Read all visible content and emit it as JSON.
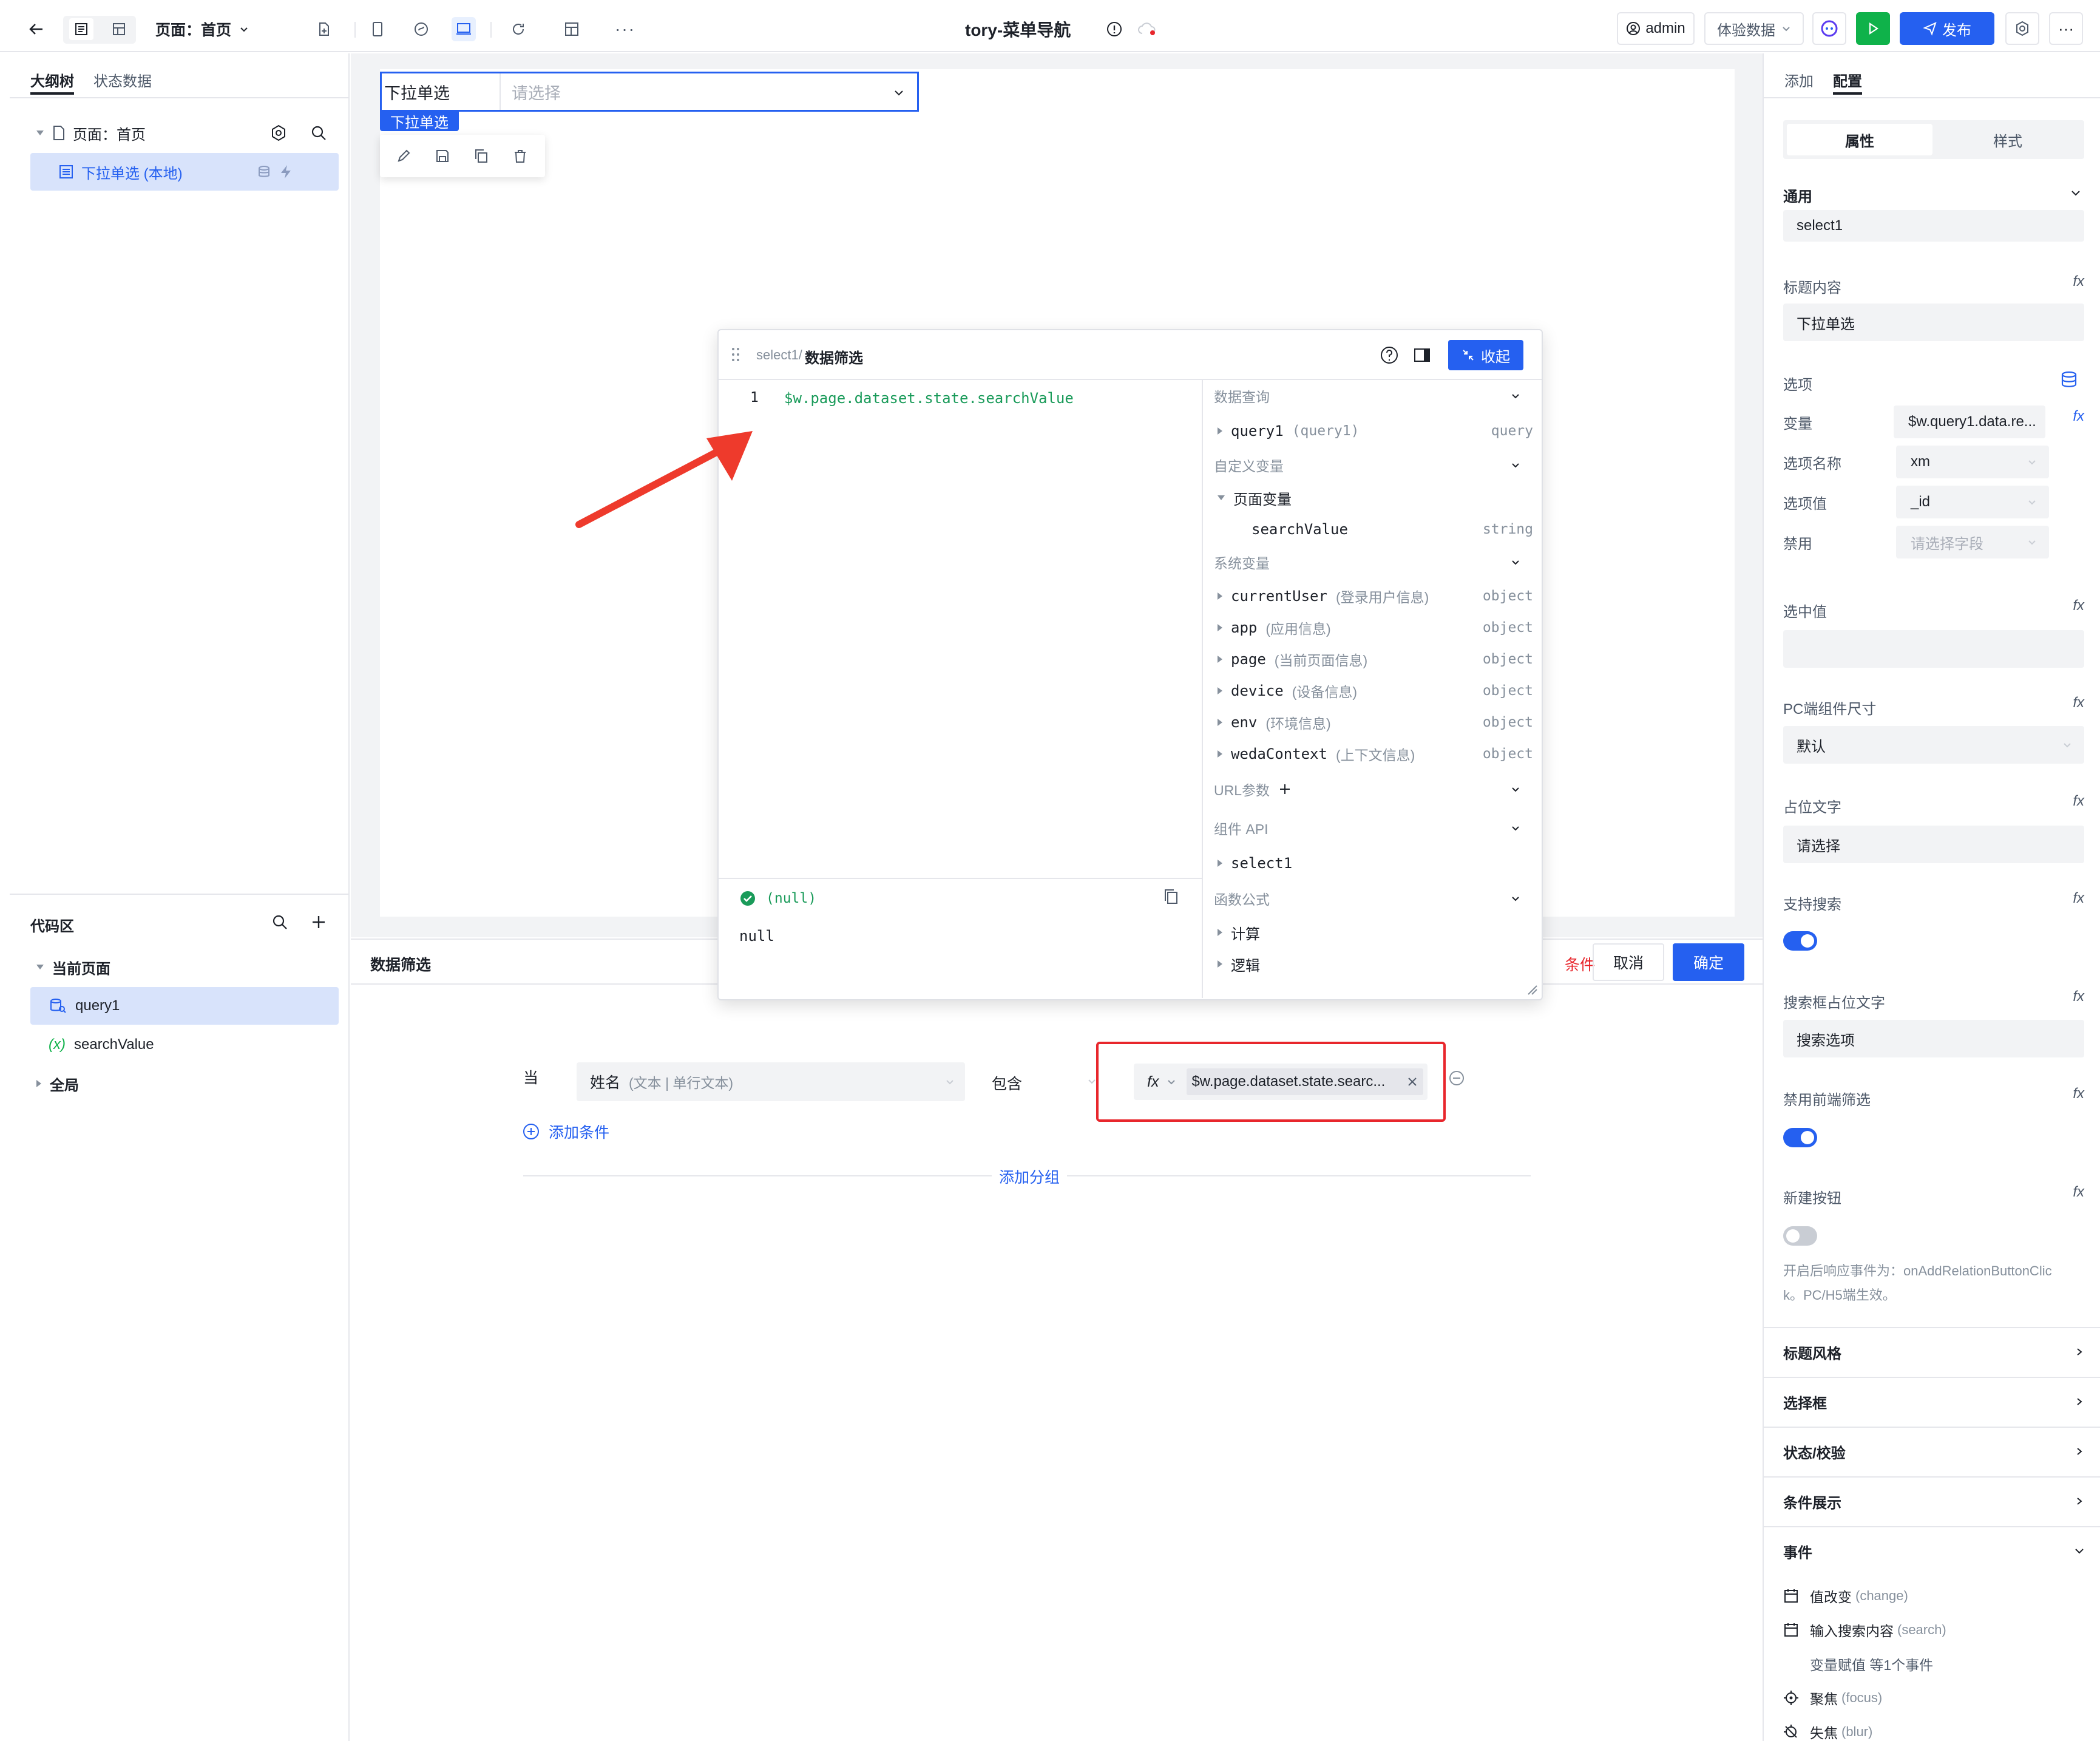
{
  "topbar": {
    "page_selector": "页面：首页",
    "app_title": "tory-菜单导航",
    "user": "admin",
    "experience_data": "体验数据",
    "publish": "发布"
  },
  "left": {
    "tabs": [
      "大纲树",
      "状态数据"
    ],
    "tree": {
      "page": "页面：首页",
      "component": "下拉单选 (本地)"
    },
    "code": {
      "title": "代码区",
      "current_page": "当前页面",
      "query": "query1",
      "variable": "searchValue",
      "global": "全局"
    }
  },
  "canvas": {
    "select_label": "下拉单选",
    "select_placeholder": "请选择",
    "select_badge": "下拉单选"
  },
  "editor": {
    "breadcrumb_prefix": "select1/",
    "breadcrumb_title": "数据筛选",
    "collapse": "收起",
    "line_number": "1",
    "code": "$w.page.dataset.state.searchValue",
    "result_status": "(null)",
    "result_value": "null",
    "sections": {
      "data_query": "数据查询",
      "custom_vars": "自定义变量",
      "system_vars": "系统变量",
      "url_params": "URL参数",
      "component_api": "组件 API",
      "functions": "函数公式"
    },
    "query_item": {
      "name": "query1",
      "hint": "(query1)",
      "type": "query"
    },
    "page_vars": "页面变量",
    "search_var": {
      "name": "searchValue",
      "type": "string"
    },
    "system_items": [
      {
        "name": "currentUser",
        "hint": "(登录用户信息)",
        "type": "object"
      },
      {
        "name": "app",
        "hint": "(应用信息)",
        "type": "object"
      },
      {
        "name": "page",
        "hint": "(当前页面信息)",
        "type": "object"
      },
      {
        "name": "device",
        "hint": "(设备信息)",
        "type": "object"
      },
      {
        "name": "env",
        "hint": "(环境信息)",
        "type": "object"
      },
      {
        "name": "wedaContext",
        "hint": "(上下文信息)",
        "type": "object"
      }
    ],
    "component_item": "select1",
    "function_items": [
      "计算",
      "逻辑"
    ]
  },
  "filter": {
    "title": "数据筛选",
    "partial_label": "条件",
    "cancel": "取消",
    "confirm": "确定",
    "when": "当",
    "field": "姓名",
    "field_hint": "(文本 | 单行文本)",
    "operator": "包含",
    "fx": "fx",
    "value": "$w.page.dataset.state.searc...",
    "add_condition": "添加条件",
    "add_group": "添加分组"
  },
  "right": {
    "tabs": [
      "添加",
      "配置"
    ],
    "seg": [
      "属性",
      "样式"
    ],
    "general": "通用",
    "id_value": "select1",
    "title_label": "标题内容",
    "title_value": "下拉单选",
    "options_label": "选项",
    "variable_label": "变量",
    "variable_value": "$w.query1.data.re...",
    "option_name_label": "选项名称",
    "option_name_value": "xm",
    "option_value_label": "选项值",
    "option_value_value": "_id",
    "disabled_label": "禁用",
    "disabled_placeholder": "请选择字段",
    "selected_label": "选中值",
    "size_label": "PC端组件尺寸",
    "size_value": "默认",
    "placeholder_label": "占位文字",
    "placeholder_value": "请选择",
    "search_label": "支持搜索",
    "search_placeholder_label": "搜索框占位文字",
    "search_placeholder_value": "搜索选项",
    "frontend_filter_label": "禁用前端筛选",
    "new_button_label": "新建按钮",
    "new_button_hint": "开启后响应事件为：onAddRelationButtonClick。PC/H5端生效。",
    "new_button_hint_line1": "开启后响应事件为：onAddRelationButtonClic",
    "new_button_hint_line2": "k。PC/H5端生效。",
    "sections": [
      "标题风格",
      "选择框",
      "状态/校验",
      "条件展示"
    ],
    "events_title": "事件",
    "events": [
      {
        "label": "值改变",
        "sub": "(change)"
      },
      {
        "label": "输入搜索内容",
        "sub": "(search)"
      },
      {
        "label": "变量赋值 等1个事件",
        "sub": ""
      },
      {
        "label": "聚焦",
        "sub": "(focus)"
      },
      {
        "label": "失焦",
        "sub": "(blur)"
      }
    ],
    "fx": "fx"
  },
  "colors": {
    "primary": "#2560f0",
    "highlight_red": "#e8262c",
    "arrow_red": "#ee3a2c",
    "code_green": "#1a9b5a"
  }
}
